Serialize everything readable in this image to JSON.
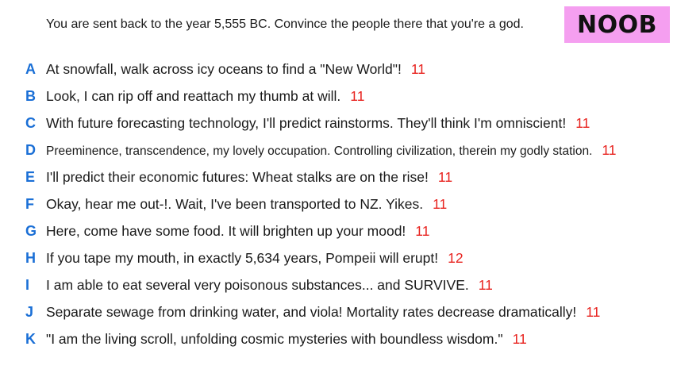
{
  "prompt": "You are sent back to the year 5,555 BC. Convince the people there that you're a god.",
  "badge": {
    "label": "NOOB",
    "background": "#f59ff0"
  },
  "colors": {
    "letter": "#1a6fd6",
    "score": "#e8231f",
    "text": "#1a1a1a"
  },
  "options": [
    {
      "letter": "A",
      "text": "At snowfall, walk across icy oceans to find a \"New World\"!",
      "score": "11"
    },
    {
      "letter": "B",
      "text": "Look, I can rip off and reattach my thumb at will.",
      "score": "11"
    },
    {
      "letter": "C",
      "text": "With future forecasting technology, I'll predict rainstorms. They'll think I'm omniscient!",
      "score": "11"
    },
    {
      "letter": "D",
      "text": "Preeminence, transcendence, my lovely occupation. Controlling civilization, therein my godly station.",
      "score": "11"
    },
    {
      "letter": "E",
      "text": "I'll predict their economic futures: Wheat stalks are on the rise!",
      "score": "11"
    },
    {
      "letter": "F",
      "text": "Okay, hear me out-!. Wait, I've been transported to NZ. Yikes.",
      "score": "11"
    },
    {
      "letter": "G",
      "text": "Here, come have some food. It will brighten up your mood!",
      "score": "11"
    },
    {
      "letter": "H",
      "text": "If you tape my mouth, in exactly 5,634 years, Pompeii will erupt!",
      "score": "12"
    },
    {
      "letter": "I",
      "text": "I am able to eat several very poisonous substances... and SURVIVE.",
      "score": "11"
    },
    {
      "letter": "J",
      "text": "Separate sewage from drinking water, and viola! Mortality rates decrease dramatically!",
      "score": "11"
    },
    {
      "letter": "K",
      "text": "\"I am the living scroll, unfolding cosmic mysteries with boundless wisdom.\"",
      "score": "11"
    }
  ]
}
